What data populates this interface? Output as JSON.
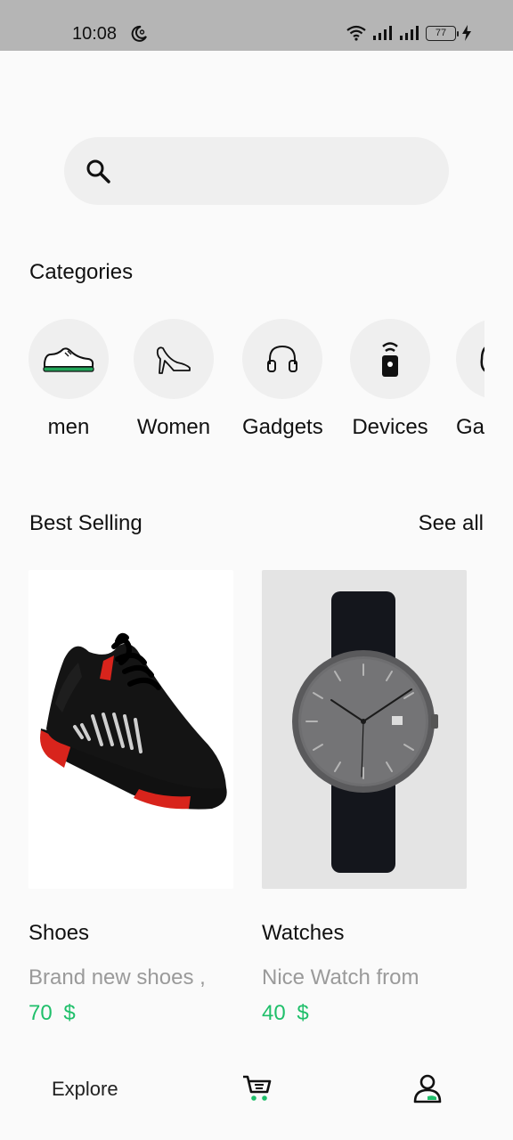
{
  "status_bar": {
    "time": "10:08",
    "battery": "77"
  },
  "search": {
    "placeholder": ""
  },
  "categories": {
    "title": "Categories",
    "items": [
      {
        "label": "men",
        "icon": "sneaker-icon"
      },
      {
        "label": "Women",
        "icon": "high-heel-icon"
      },
      {
        "label": "Gadgets",
        "icon": "headphones-icon"
      },
      {
        "label": "Devices",
        "icon": "remote-icon"
      },
      {
        "label": "Ga",
        "icon": "game-icon"
      }
    ]
  },
  "best_selling": {
    "title": "Best Selling",
    "see_all": "See all",
    "products": [
      {
        "title": "Shoes",
        "description": "Brand new shoes ,",
        "price": "70 $"
      },
      {
        "title": "Watches",
        "description": "Nice Watch from",
        "price": "40 $"
      }
    ]
  },
  "bottom_nav": {
    "explore_label": "Explore"
  },
  "colors": {
    "accent": "#1fbf6a",
    "status_bar": "#b5b5b5",
    "chip_bg": "#efefef"
  }
}
